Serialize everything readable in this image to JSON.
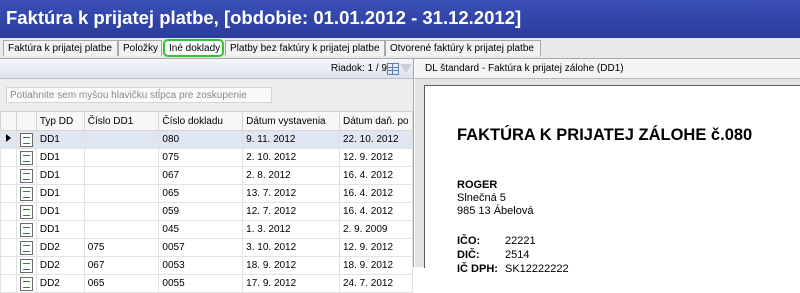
{
  "window": {
    "title": "Faktúra k prijatej platbe, [obdobie: 01.01.2012 - 31.12.2012]"
  },
  "tabs": [
    {
      "label": "Faktúra k prijatej platbe"
    },
    {
      "label": "Položky"
    },
    {
      "label": "Iné doklady",
      "active": true
    },
    {
      "label": "Platby bez faktúry k prijatej platbe"
    },
    {
      "label": "Otvorené faktúry k prijatej platbe"
    }
  ],
  "grid": {
    "row_count_label": "Riadok: 1 / 9",
    "group_hint": "Potiahnite sem myšou hlavičku stĺpca pre zoskupenie",
    "columns": [
      "Typ DD",
      "Číslo DD1",
      "Číslo dokladu",
      "Dátum vystavenia",
      "Dátum daň. po"
    ],
    "rows": [
      [
        "DD1",
        "",
        "080",
        "9. 11. 2012",
        "22. 10. 2012"
      ],
      [
        "DD1",
        "",
        "075",
        "2. 10. 2012",
        "12. 9. 2012"
      ],
      [
        "DD1",
        "",
        "067",
        "2. 8. 2012",
        "16. 4. 2012"
      ],
      [
        "DD1",
        "",
        "065",
        "13. 7. 2012",
        "16. 4. 2012"
      ],
      [
        "DD1",
        "",
        "059",
        "12. 7. 2012",
        "16. 4. 2012"
      ],
      [
        "DD1",
        "",
        "045",
        "1. 3. 2012",
        "2. 9. 2009"
      ],
      [
        "DD2",
        "075",
        "0057",
        "3. 10. 2012",
        "12. 9. 2012"
      ],
      [
        "DD2",
        "067",
        "0053",
        "18. 9. 2012",
        "18. 9. 2012"
      ],
      [
        "DD2",
        "065",
        "0055",
        "17. 9. 2012",
        "24. 7. 2012"
      ]
    ]
  },
  "preview": {
    "header": "DL štandard - Faktúra k prijatej zálohe (DD1)",
    "doc_title": "FAKTÚRA K PRIJATEJ ZÁLOHE č.080",
    "company": "ROGER",
    "street": "Slnečná 5",
    "city": "985 13  Ábelová",
    "ico_label": "IČO:",
    "ico_value": "22221",
    "dic_label": "DIČ:",
    "dic_value": "2514",
    "icdph_label": "IČ DPH:",
    "icdph_value": "SK12222222"
  }
}
